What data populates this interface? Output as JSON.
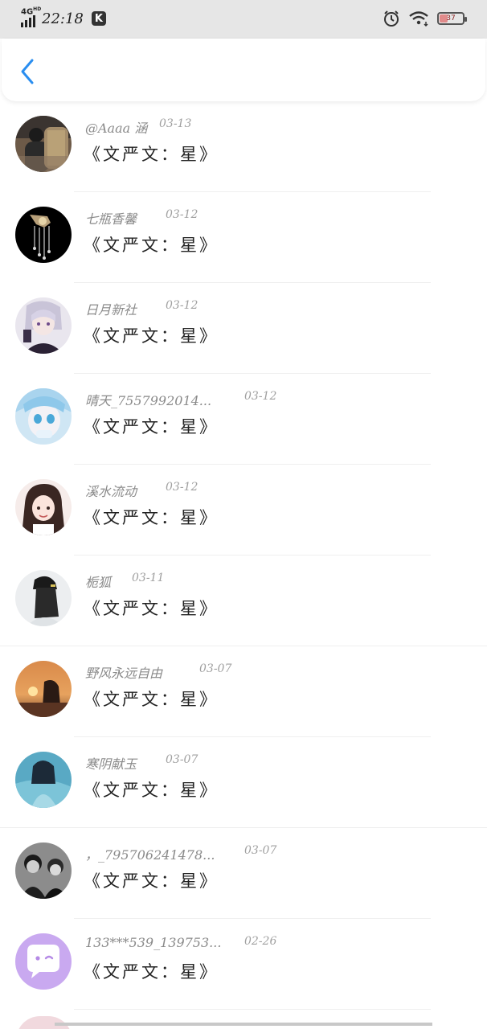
{
  "status_bar": {
    "network": "4G",
    "network_hd": "HD",
    "time": "22:18",
    "app_badge": "K",
    "battery_percent": "37",
    "battery_level": 0.37,
    "icons": [
      "alarm-icon",
      "wifi-icon",
      "battery-icon"
    ]
  },
  "header": {
    "back_icon": "chevron-left-icon",
    "accent_color": "#2a8ef0"
  },
  "comments": [
    {
      "username": "@Aaaa 涵",
      "date": "03-13",
      "text": "《文严文：星》"
    },
    {
      "username": "七瓶香馨",
      "date": "03-12",
      "text": "《文严文：星》"
    },
    {
      "username": "日月新社",
      "date": "03-12",
      "text": "《文严文：星》"
    },
    {
      "username": "晴天_7557992014...",
      "date": "03-12",
      "text": "《文严文：星》"
    },
    {
      "username": "溪水流动",
      "date": "03-12",
      "text": "《文严文：星》"
    },
    {
      "username": "栀狐",
      "date": "03-11",
      "text": "《文严文：星》"
    },
    {
      "username": "野风永远自由",
      "date": "03-07",
      "text": "《文严文：星》"
    },
    {
      "username": "寒阴献玉",
      "date": "03-07",
      "text": "《文严文：星》"
    },
    {
      "username": "，_795706241478...",
      "date": "03-07",
      "text": "《文严文：星》"
    },
    {
      "username": "133***539_139753...",
      "date": "02-26",
      "text": "《文严文：星》"
    }
  ]
}
